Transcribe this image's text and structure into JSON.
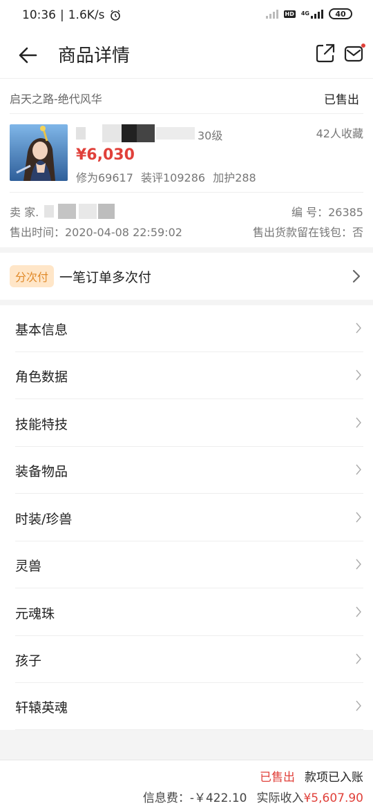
{
  "status_bar": {
    "time": "10:36",
    "network_speed": "1.6K/s",
    "net_type": "HD",
    "net_gen": "4G",
    "battery": "40"
  },
  "nav": {
    "title": "商品详情",
    "notification_color": "#e0403a"
  },
  "product": {
    "game_server": "启天之路-绝代风华",
    "status": "已售出",
    "level_suffix": "30级",
    "favorites": "42人收藏",
    "price": "¥6,030",
    "xiuwei": "修为69617",
    "zhuangping": "装评109286",
    "jiahu": "加护288",
    "seller_label": "卖 家.",
    "serial": "编  号：26385",
    "sold_time": "售出时间：2020-04-08 22:59:02",
    "wallet": "售出货款留在钱包：否"
  },
  "installment": {
    "tag": "分次付",
    "text": "一笔订单多次付"
  },
  "menu": [
    {
      "label": "基本信息"
    },
    {
      "label": "角色数据"
    },
    {
      "label": "技能特技"
    },
    {
      "label": "装备物品"
    },
    {
      "label": "时装/珍兽"
    },
    {
      "label": "灵兽"
    },
    {
      "label": "元魂珠"
    },
    {
      "label": "孩子"
    },
    {
      "label": "轩辕英魂"
    }
  ],
  "footer": {
    "status_sold": "已售出",
    "status_paid": "款项已入账",
    "fee_label": "信息费：-￥422.10",
    "income_label": "实际收入",
    "income_value": "¥5,607.90"
  },
  "colors": {
    "accent_red": "#e0403a",
    "tag_bg": "#ffe6c8",
    "tag_text": "#e08a2a"
  }
}
